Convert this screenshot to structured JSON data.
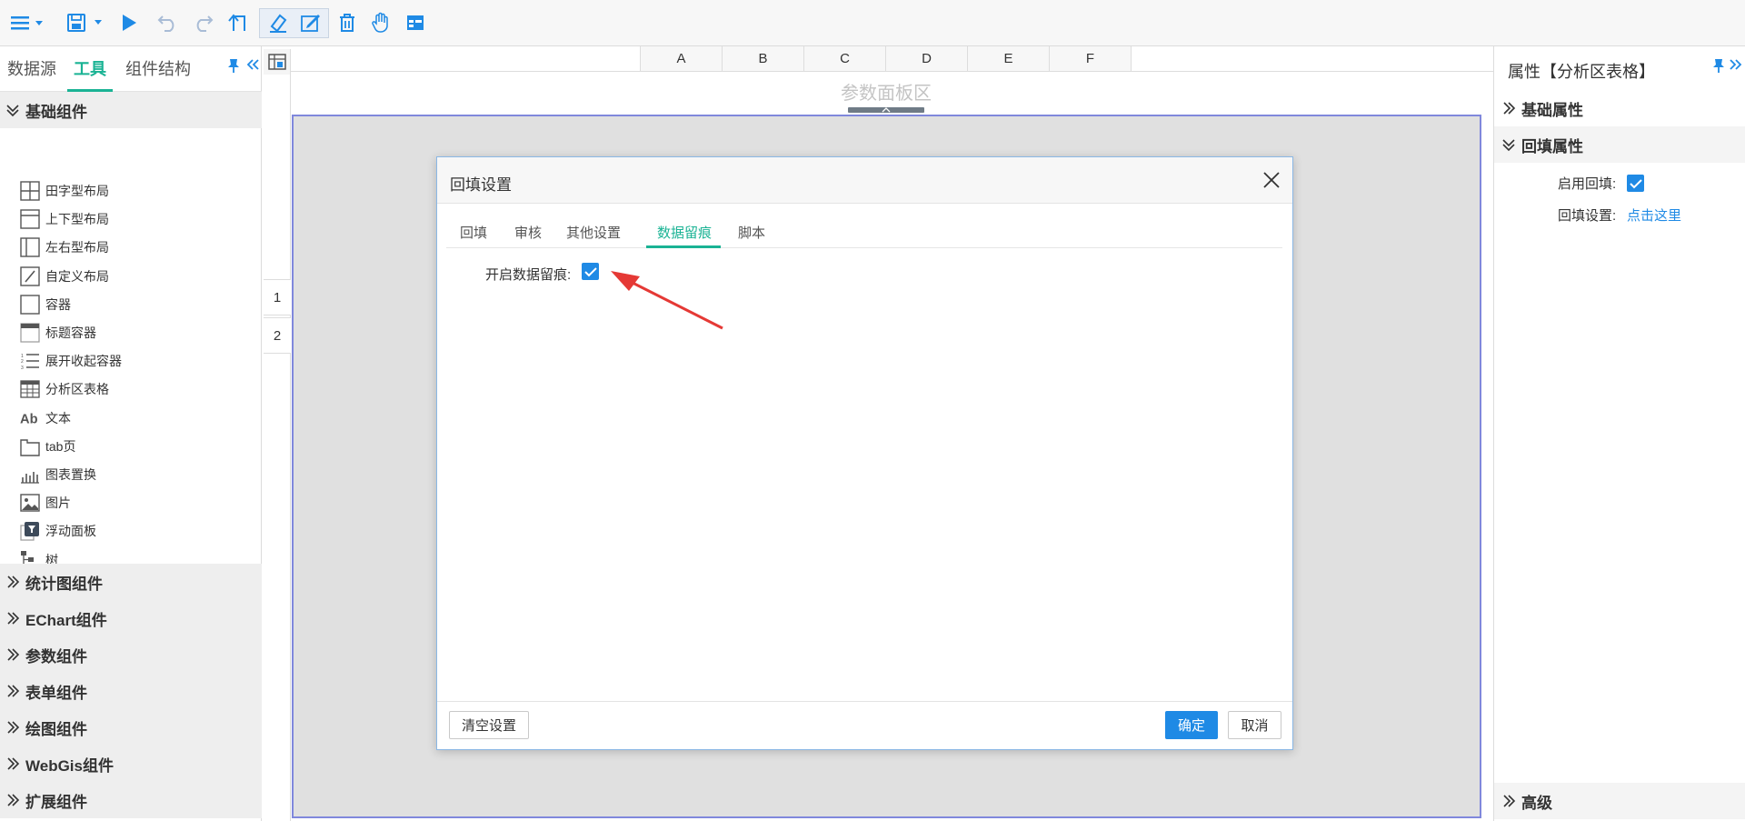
{
  "toolbar": {
    "icons": [
      "menu-icon",
      "save-icon",
      "run-icon",
      "undo-icon",
      "redo-icon",
      "upload-icon",
      "eraser-icon",
      "edit-icon",
      "delete-icon",
      "hand-icon",
      "layout-icon"
    ]
  },
  "left_panel": {
    "tabs": [
      "数据源",
      "工具",
      "组件结构"
    ],
    "active_tab": "工具",
    "basic_section": "基础组件",
    "components": [
      {
        "label": "田字型布局",
        "icon": "grid-layout-icon"
      },
      {
        "label": "上下型布局",
        "icon": "top-bottom-layout-icon"
      },
      {
        "label": "左右型布局",
        "icon": "left-right-layout-icon"
      },
      {
        "label": "自定义布局",
        "icon": "custom-layout-icon"
      },
      {
        "label": "容器",
        "icon": "container-icon"
      },
      {
        "label": "标题容器",
        "icon": "title-container-icon"
      },
      {
        "label": "展开收起容器",
        "icon": "collapse-container-icon"
      },
      {
        "label": "分析区表格",
        "icon": "table-icon"
      },
      {
        "label": "文本",
        "icon": "text-icon"
      },
      {
        "label": "tab页",
        "icon": "tab-icon"
      },
      {
        "label": "图表置换",
        "icon": "chart-swap-icon"
      },
      {
        "label": "图片",
        "icon": "image-icon"
      },
      {
        "label": "浮动面板",
        "icon": "float-panel-icon"
      },
      {
        "label": "树",
        "icon": "tree-icon"
      }
    ],
    "collapsed_sections": [
      "统计图组件",
      "EChart组件",
      "参数组件",
      "表单组件",
      "绘图组件",
      "WebGis组件",
      "扩展组件"
    ]
  },
  "sheet": {
    "columns": [
      "A",
      "B",
      "C",
      "D",
      "E",
      "F"
    ],
    "rows": [
      "1",
      "2"
    ],
    "param_area_title": "参数面板区"
  },
  "right_panel": {
    "title": "属性【分析区表格】",
    "sections": [
      "基础属性",
      "回填属性"
    ],
    "enable_fill_label": "启用回填:",
    "enable_fill_checked": true,
    "fill_setting_label": "回填设置:",
    "fill_setting_link": "点击这里",
    "advanced_section": "高级"
  },
  "dialog": {
    "title": "回填设置",
    "tabs": [
      "回填",
      "审核",
      "其他设置",
      "数据留痕",
      "脚本"
    ],
    "active_tab": "数据留痕",
    "field_label": "开启数据留痕:",
    "field_checked": true,
    "clear_button": "清空设置",
    "ok_button": "确定",
    "cancel_button": "取消"
  },
  "colors": {
    "accent_green": "#1ab394",
    "primary_blue": "#1f8ae5",
    "design_border": "#8088dc",
    "annotation_red": "#e53935"
  }
}
